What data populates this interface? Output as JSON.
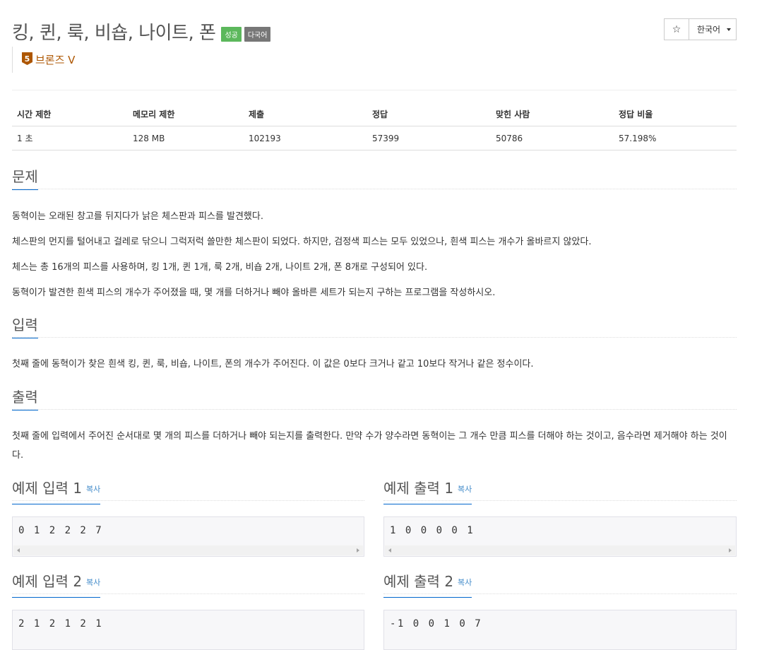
{
  "problem": {
    "title": "킹, 퀸, 룩, 비숍, 나이트, 폰",
    "labels": {
      "success": "성공",
      "multilang": "다국어"
    },
    "tier": {
      "number": "5",
      "name": "브론즈 V",
      "color": "#ad5600"
    }
  },
  "controls": {
    "star_icon": "star-icon",
    "star_glyph": "☆",
    "language": "한국어"
  },
  "info": {
    "headers": [
      "시간 제한",
      "메모리 제한",
      "제출",
      "정답",
      "맞힌 사람",
      "정답 비율"
    ],
    "values": [
      "1 초",
      "128 MB",
      "102193",
      "57399",
      "50786",
      "57.198%"
    ]
  },
  "sections": {
    "description": {
      "title": "문제",
      "paragraphs": [
        "동혁이는 오래된 창고를 뒤지다가 낡은 체스판과 피스를 발견했다.",
        "체스판의 먼지를 털어내고 걸레로 닦으니 그럭저럭 쓸만한 체스판이 되었다. 하지만, 검정색 피스는 모두 있었으나, 흰색 피스는 개수가 올바르지 않았다.",
        "체스는 총 16개의 피스를 사용하며, 킹 1개, 퀸 1개, 룩 2개, 비숍 2개, 나이트 2개, 폰 8개로 구성되어 있다.",
        "동혁이가 발견한 흰색 피스의 개수가 주어졌을 때, 몇 개를 더하거나 빼야 올바른 세트가 되는지 구하는 프로그램을 작성하시오."
      ]
    },
    "input": {
      "title": "입력",
      "text": "첫째 줄에 동혁이가 찾은 흰색 킹, 퀸, 룩, 비숍, 나이트, 폰의 개수가 주어진다. 이 값은 0보다 크거나 같고 10보다 작거나 같은 정수이다."
    },
    "output": {
      "title": "출력",
      "text": "첫째 줄에 입력에서 주어진 순서대로 몇 개의 피스를 더하거나 빼야 되는지를 출력한다. 만약 수가 양수라면 동혁이는 그 개수 만큼 피스를 더해야 하는 것이고, 음수라면 제거해야 하는 것이다."
    }
  },
  "samples": [
    {
      "input_title": "예제 입력 1",
      "output_title": "예제 출력 1",
      "copy": "복사",
      "input": "0 1 2 2 2 7",
      "output": "1 0 0 0 0 1"
    },
    {
      "input_title": "예제 입력 2",
      "output_title": "예제 출력 2",
      "copy": "복사",
      "input": "2 1 2 1 2 1",
      "output": "-1 0 0 1 0 7"
    }
  ]
}
